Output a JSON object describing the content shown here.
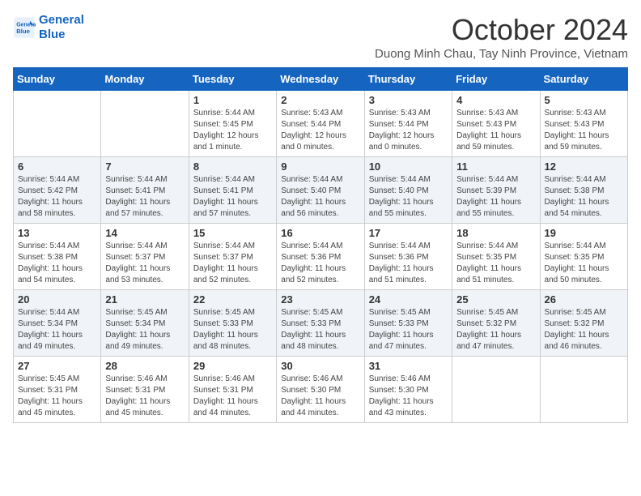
{
  "header": {
    "logo_line1": "General",
    "logo_line2": "Blue",
    "month_title": "October 2024",
    "subtitle": "Duong Minh Chau, Tay Ninh Province, Vietnam"
  },
  "days_of_week": [
    "Sunday",
    "Monday",
    "Tuesday",
    "Wednesday",
    "Thursday",
    "Friday",
    "Saturday"
  ],
  "weeks": [
    [
      {
        "day": "",
        "content": ""
      },
      {
        "day": "",
        "content": ""
      },
      {
        "day": "1",
        "content": "Sunrise: 5:44 AM\nSunset: 5:45 PM\nDaylight: 12 hours and 1 minute."
      },
      {
        "day": "2",
        "content": "Sunrise: 5:43 AM\nSunset: 5:44 PM\nDaylight: 12 hours and 0 minutes."
      },
      {
        "day": "3",
        "content": "Sunrise: 5:43 AM\nSunset: 5:44 PM\nDaylight: 12 hours and 0 minutes."
      },
      {
        "day": "4",
        "content": "Sunrise: 5:43 AM\nSunset: 5:43 PM\nDaylight: 11 hours and 59 minutes."
      },
      {
        "day": "5",
        "content": "Sunrise: 5:43 AM\nSunset: 5:43 PM\nDaylight: 11 hours and 59 minutes."
      }
    ],
    [
      {
        "day": "6",
        "content": "Sunrise: 5:44 AM\nSunset: 5:42 PM\nDaylight: 11 hours and 58 minutes."
      },
      {
        "day": "7",
        "content": "Sunrise: 5:44 AM\nSunset: 5:41 PM\nDaylight: 11 hours and 57 minutes."
      },
      {
        "day": "8",
        "content": "Sunrise: 5:44 AM\nSunset: 5:41 PM\nDaylight: 11 hours and 57 minutes."
      },
      {
        "day": "9",
        "content": "Sunrise: 5:44 AM\nSunset: 5:40 PM\nDaylight: 11 hours and 56 minutes."
      },
      {
        "day": "10",
        "content": "Sunrise: 5:44 AM\nSunset: 5:40 PM\nDaylight: 11 hours and 55 minutes."
      },
      {
        "day": "11",
        "content": "Sunrise: 5:44 AM\nSunset: 5:39 PM\nDaylight: 11 hours and 55 minutes."
      },
      {
        "day": "12",
        "content": "Sunrise: 5:44 AM\nSunset: 5:38 PM\nDaylight: 11 hours and 54 minutes."
      }
    ],
    [
      {
        "day": "13",
        "content": "Sunrise: 5:44 AM\nSunset: 5:38 PM\nDaylight: 11 hours and 54 minutes."
      },
      {
        "day": "14",
        "content": "Sunrise: 5:44 AM\nSunset: 5:37 PM\nDaylight: 11 hours and 53 minutes."
      },
      {
        "day": "15",
        "content": "Sunrise: 5:44 AM\nSunset: 5:37 PM\nDaylight: 11 hours and 52 minutes."
      },
      {
        "day": "16",
        "content": "Sunrise: 5:44 AM\nSunset: 5:36 PM\nDaylight: 11 hours and 52 minutes."
      },
      {
        "day": "17",
        "content": "Sunrise: 5:44 AM\nSunset: 5:36 PM\nDaylight: 11 hours and 51 minutes."
      },
      {
        "day": "18",
        "content": "Sunrise: 5:44 AM\nSunset: 5:35 PM\nDaylight: 11 hours and 51 minutes."
      },
      {
        "day": "19",
        "content": "Sunrise: 5:44 AM\nSunset: 5:35 PM\nDaylight: 11 hours and 50 minutes."
      }
    ],
    [
      {
        "day": "20",
        "content": "Sunrise: 5:44 AM\nSunset: 5:34 PM\nDaylight: 11 hours and 49 minutes."
      },
      {
        "day": "21",
        "content": "Sunrise: 5:45 AM\nSunset: 5:34 PM\nDaylight: 11 hours and 49 minutes."
      },
      {
        "day": "22",
        "content": "Sunrise: 5:45 AM\nSunset: 5:33 PM\nDaylight: 11 hours and 48 minutes."
      },
      {
        "day": "23",
        "content": "Sunrise: 5:45 AM\nSunset: 5:33 PM\nDaylight: 11 hours and 48 minutes."
      },
      {
        "day": "24",
        "content": "Sunrise: 5:45 AM\nSunset: 5:33 PM\nDaylight: 11 hours and 47 minutes."
      },
      {
        "day": "25",
        "content": "Sunrise: 5:45 AM\nSunset: 5:32 PM\nDaylight: 11 hours and 47 minutes."
      },
      {
        "day": "26",
        "content": "Sunrise: 5:45 AM\nSunset: 5:32 PM\nDaylight: 11 hours and 46 minutes."
      }
    ],
    [
      {
        "day": "27",
        "content": "Sunrise: 5:45 AM\nSunset: 5:31 PM\nDaylight: 11 hours and 45 minutes."
      },
      {
        "day": "28",
        "content": "Sunrise: 5:46 AM\nSunset: 5:31 PM\nDaylight: 11 hours and 45 minutes."
      },
      {
        "day": "29",
        "content": "Sunrise: 5:46 AM\nSunset: 5:31 PM\nDaylight: 11 hours and 44 minutes."
      },
      {
        "day": "30",
        "content": "Sunrise: 5:46 AM\nSunset: 5:30 PM\nDaylight: 11 hours and 44 minutes."
      },
      {
        "day": "31",
        "content": "Sunrise: 5:46 AM\nSunset: 5:30 PM\nDaylight: 11 hours and 43 minutes."
      },
      {
        "day": "",
        "content": ""
      },
      {
        "day": "",
        "content": ""
      }
    ]
  ]
}
